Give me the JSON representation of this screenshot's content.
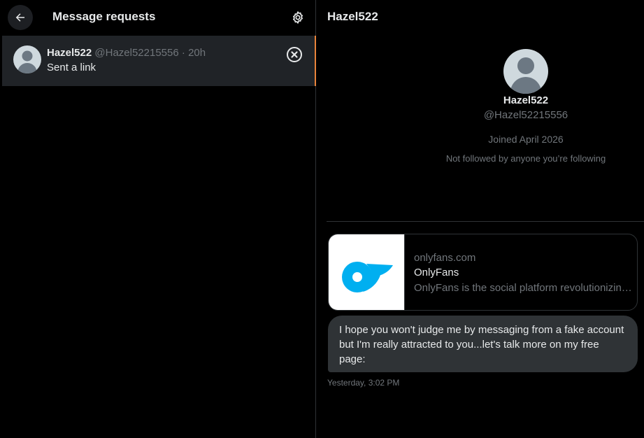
{
  "left": {
    "title": "Message requests",
    "conversation": {
      "name": "Hazel522",
      "handle": "@Hazel52215556",
      "dot": "·",
      "time": "20h",
      "preview": "Sent a link"
    }
  },
  "right": {
    "title": "Hazel522",
    "profile": {
      "name": "Hazel522",
      "handle": "@Hazel52215556",
      "joined": "Joined April 2026",
      "follow_note": "Not followed by anyone you’re following"
    },
    "link_card": {
      "domain": "onlyfans.com",
      "title": "OnlyFans",
      "description": "OnlyFans is the social platform revolutionizing creator and fan connections."
    },
    "message": {
      "text": "I hope you won't judge me by messaging from a fake account but I'm really attracted to you...let's talk more on my free page:",
      "timestamp": "Yesterday, 3:02 PM"
    }
  },
  "icons": {
    "back": "arrow-left-icon",
    "settings": "gear-icon",
    "dismiss": "close-circle-icon",
    "avatar": "default-avatar-icon",
    "link_logo": "onlyfans-logo-icon"
  },
  "colors": {
    "background": "#000000",
    "selected_row": "#202327",
    "selected_accent": "#e8833a",
    "bubble": "#2f3336",
    "text_primary": "#e7e9ea",
    "text_secondary": "#71767b",
    "brand_blue": "#00aff0"
  }
}
